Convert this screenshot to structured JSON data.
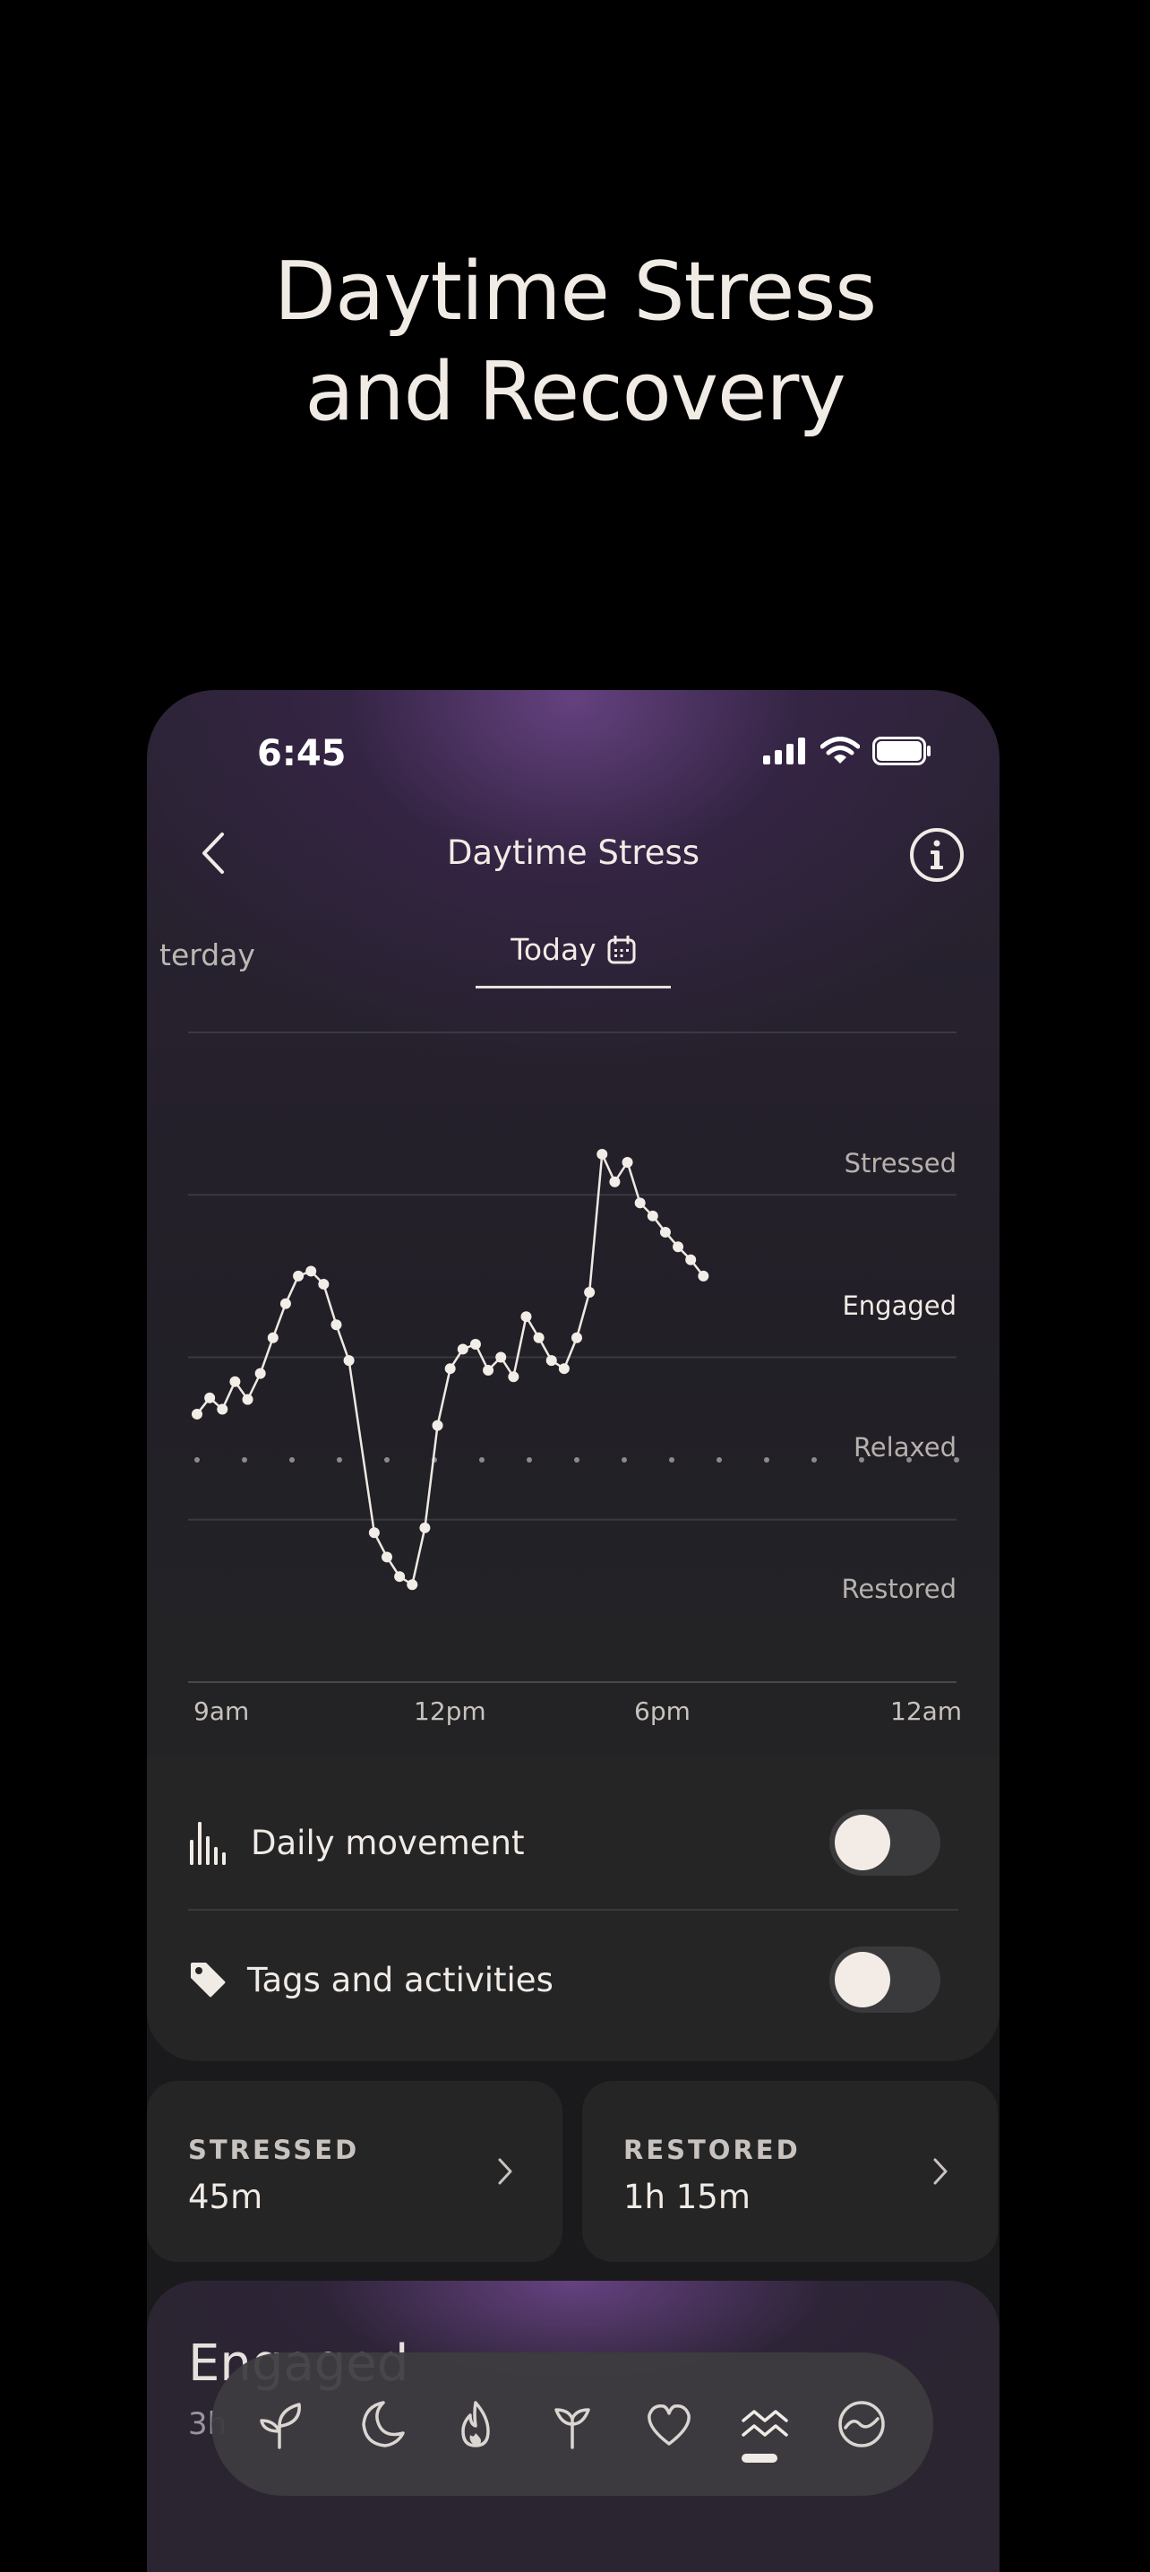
{
  "promo": {
    "title_line1": "Daytime Stress",
    "title_line2": "and Recovery"
  },
  "status_bar": {
    "time": "6:45"
  },
  "header": {
    "title": "Daytime Stress"
  },
  "day_tabs": {
    "previous": "terday",
    "current": "Today"
  },
  "chart_data": {
    "type": "line",
    "x_tick_labels": [
      "9am",
      "12pm",
      "6pm",
      "12am"
    ],
    "y_levels": [
      "Stressed",
      "Engaged",
      "Relaxed",
      "Restored"
    ],
    "y_active_level": "Engaged",
    "xlim_hours": [
      9,
      24
    ],
    "y_scale": "0 = Restored, 1 = Relaxed, 2 = Engaged, 3 = Stressed",
    "series": [
      {
        "x": [
          9.0,
          9.25,
          9.5,
          9.75,
          10.0,
          10.25,
          10.5,
          10.75,
          11.0,
          11.25,
          11.5,
          11.75,
          12.0,
          12.5,
          12.75,
          13.0,
          13.25,
          13.5,
          13.75,
          14.0,
          14.25,
          14.5,
          14.75,
          15.0,
          15.25,
          15.5,
          15.75,
          16.0,
          16.25,
          16.5,
          16.75,
          17.0,
          17.25,
          17.5,
          17.75,
          18.0,
          18.25,
          18.5,
          18.75,
          19.0
        ],
        "y": [
          1.65,
          1.75,
          1.68,
          1.85,
          1.74,
          1.9,
          2.12,
          2.33,
          2.5,
          2.53,
          2.45,
          2.2,
          1.98,
          0.92,
          0.77,
          0.65,
          0.6,
          0.95,
          1.58,
          1.93,
          2.05,
          2.08,
          1.92,
          2.0,
          1.88,
          2.25,
          2.12,
          1.98,
          1.93,
          2.12,
          2.4,
          3.25,
          3.08,
          3.2,
          2.95,
          2.87,
          2.77,
          2.68,
          2.6,
          2.5
        ]
      }
    ]
  },
  "toggles": [
    {
      "label": "Daily movement",
      "on": false
    },
    {
      "label": "Tags and activities",
      "on": false
    }
  ],
  "stats": [
    {
      "label": "STRESSED",
      "value": "45m"
    },
    {
      "label": "RESTORED",
      "value": "1h 15m"
    }
  ],
  "engaged_card": {
    "title": "Engaged",
    "subtitle": "3h"
  },
  "tabbar": {
    "icons": [
      "sprout-icon",
      "moon-icon",
      "flame-icon",
      "sprout-branch-icon",
      "heart-icon",
      "waves-icon",
      "trend-circle-icon"
    ],
    "active_index": 5
  }
}
